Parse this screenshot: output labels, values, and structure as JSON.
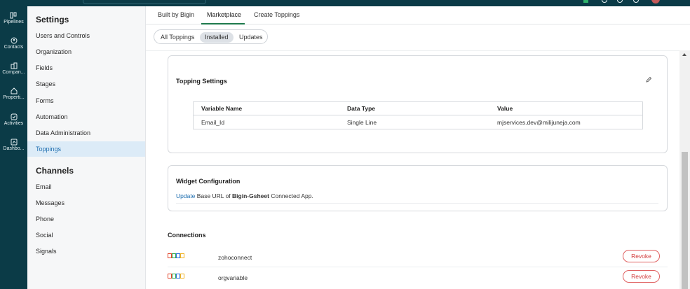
{
  "rail": {
    "items": [
      {
        "label": "Pipelines",
        "icon": "pipelines-icon"
      },
      {
        "label": "Contacts",
        "icon": "contacts-icon"
      },
      {
        "label": "Compan...",
        "icon": "companies-icon"
      },
      {
        "label": "Properti...",
        "icon": "properties-icon"
      },
      {
        "label": "Activities",
        "icon": "activities-icon"
      },
      {
        "label": "Dashbo...",
        "icon": "dashboards-icon"
      }
    ]
  },
  "sidebar": {
    "settings_heading": "Settings",
    "settings_items": [
      {
        "label": "Users and Controls"
      },
      {
        "label": "Organization"
      },
      {
        "label": "Fields"
      },
      {
        "label": "Stages"
      },
      {
        "label": "Forms"
      },
      {
        "label": "Automation"
      },
      {
        "label": "Data Administration"
      },
      {
        "label": "Toppings",
        "active": true
      }
    ],
    "channels_heading": "Channels",
    "channels_items": [
      {
        "label": "Email"
      },
      {
        "label": "Messages"
      },
      {
        "label": "Phone"
      },
      {
        "label": "Social"
      },
      {
        "label": "Signals"
      }
    ]
  },
  "main": {
    "tabs": [
      {
        "label": "Built by Bigin"
      },
      {
        "label": "Marketplace",
        "active": true
      },
      {
        "label": "Create Toppings"
      }
    ],
    "filters": [
      {
        "label": "All Toppings"
      },
      {
        "label": "Installed",
        "active": true
      },
      {
        "label": "Updates"
      }
    ],
    "topping_settings": {
      "title": "Topping Settings",
      "columns": [
        "Variable Name",
        "Data Type",
        "Value"
      ],
      "rows": [
        [
          "Email_Id",
          "Single Line",
          "mjservices.dev@milijuneja.com"
        ]
      ]
    },
    "widget_config": {
      "title": "Widget Configuration",
      "link": "Update",
      "text_before": "Base URL of",
      "app_name": "Bigin-Gsheet",
      "text_after": "Connected App."
    },
    "connections": {
      "title": "Connections",
      "items": [
        {
          "name": "zohoconnect",
          "action": "Revoke"
        },
        {
          "name": "orgvariable",
          "action": "Revoke"
        }
      ]
    }
  },
  "colors": {
    "rail_bg": "#0b3b47",
    "active_tab_underline": "#1f7a4d",
    "link": "#1f6fb0",
    "revoke": "#d23b3b",
    "active_sidebar_bg": "#dcebf7"
  }
}
